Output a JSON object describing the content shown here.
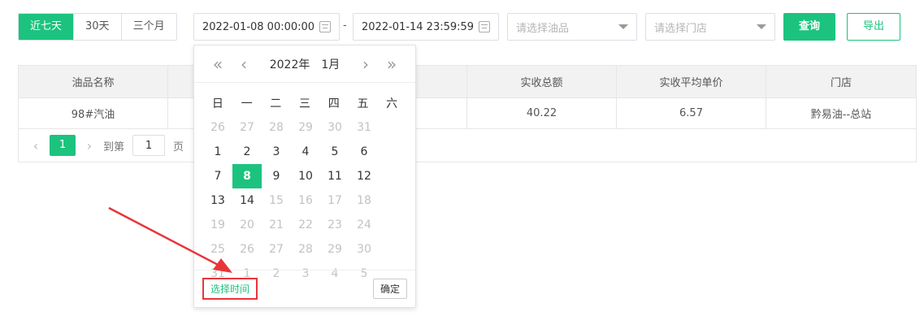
{
  "range_buttons": [
    {
      "label": "近七天",
      "active": true
    },
    {
      "label": "30天",
      "active": false
    },
    {
      "label": "三个月",
      "active": false
    }
  ],
  "date_range": {
    "start": "2022-01-08 00:00:00",
    "separator": "-",
    "end": "2022-01-14 23:59:59"
  },
  "filters": {
    "oil_placeholder": "请选择油品",
    "store_placeholder": "请选择门店"
  },
  "actions": {
    "query_label": "查询",
    "export_label": "导出"
  },
  "table": {
    "columns": [
      "油品名称",
      "",
      "",
      "实收总额",
      "实收平均单价",
      "门店"
    ],
    "rows": [
      [
        "98#汽油",
        "",
        "",
        "40.22",
        "6.57",
        "黔易油--总站"
      ]
    ]
  },
  "pager": {
    "prev": "‹",
    "current": "1",
    "next": "›",
    "goto_label": "到第",
    "goto_value": "1",
    "page_label": "页"
  },
  "datepicker": {
    "year": "2022年",
    "month": "1月",
    "weekdays": [
      "日",
      "一",
      "二",
      "三",
      "四",
      "五",
      "六"
    ],
    "days": [
      {
        "d": "26",
        "muted": true
      },
      {
        "d": "27",
        "muted": true
      },
      {
        "d": "28",
        "muted": true
      },
      {
        "d": "29",
        "muted": true
      },
      {
        "d": "30",
        "muted": true
      },
      {
        "d": "31",
        "muted": true
      },
      {
        "d": "1",
        "muted": false
      },
      {
        "d": "2",
        "muted": false
      },
      {
        "d": "3",
        "muted": false
      },
      {
        "d": "4",
        "muted": false
      },
      {
        "d": "5",
        "muted": false
      },
      {
        "d": "6",
        "muted": false
      },
      {
        "d": "7",
        "muted": false
      },
      {
        "d": "8",
        "muted": false,
        "selected": true
      },
      {
        "d": "9",
        "muted": false
      },
      {
        "d": "10",
        "muted": false
      },
      {
        "d": "11",
        "muted": false
      },
      {
        "d": "12",
        "muted": false
      },
      {
        "d": "13",
        "muted": false
      },
      {
        "d": "14",
        "muted": false
      },
      {
        "d": "15",
        "muted": true
      },
      {
        "d": "16",
        "muted": true
      },
      {
        "d": "17",
        "muted": true
      },
      {
        "d": "18",
        "muted": true
      },
      {
        "d": "19",
        "muted": true
      },
      {
        "d": "20",
        "muted": true
      },
      {
        "d": "21",
        "muted": true
      },
      {
        "d": "22",
        "muted": true
      },
      {
        "d": "23",
        "muted": true
      },
      {
        "d": "24",
        "muted": true
      },
      {
        "d": "25",
        "muted": true
      },
      {
        "d": "26",
        "muted": true
      },
      {
        "d": "27",
        "muted": true
      },
      {
        "d": "28",
        "muted": true
      },
      {
        "d": "29",
        "muted": true
      },
      {
        "d": "30",
        "muted": true
      },
      {
        "d": "31",
        "muted": true
      },
      {
        "d": "1",
        "muted": true
      },
      {
        "d": "2",
        "muted": true
      },
      {
        "d": "3",
        "muted": true
      },
      {
        "d": "4",
        "muted": true
      },
      {
        "d": "5",
        "muted": true
      }
    ],
    "pick_time_label": "选择时间",
    "confirm_label": "确定"
  },
  "colors": {
    "accent": "#1cc37e",
    "annotation": "#e8353a"
  }
}
